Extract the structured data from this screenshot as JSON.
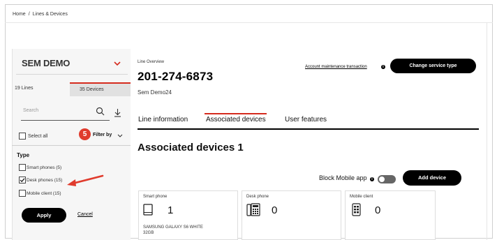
{
  "breadcrumb": {
    "home": "Home",
    "separator": "/",
    "current": "Lines & Devices"
  },
  "sidebar": {
    "account_name": "SEM DEMO",
    "tabs": {
      "lines": "19 Lines",
      "devices": "35 Devices"
    },
    "search_placeholder": "Search",
    "select_all": "Select all",
    "step_badge": "5",
    "filter_by": "Filter by",
    "type_heading": "Type",
    "options": [
      {
        "label": "Smart phones (5)",
        "checked": false
      },
      {
        "label": "Desk phones (15)",
        "checked": true
      },
      {
        "label": "Mobile client (15)",
        "checked": false
      }
    ],
    "apply": "Apply",
    "cancel": "Cancel"
  },
  "main": {
    "line_overview_label": "Line Overview",
    "phone_number": "201-274-6873",
    "line_name": "Sem Demo24",
    "account_link": "Account maintenance transaction",
    "change_service_button": "Change service type",
    "tabs": [
      {
        "label": "Line information",
        "active": false
      },
      {
        "label": "Associated devices",
        "active": true
      },
      {
        "label": "User features",
        "active": false
      }
    ],
    "section_title": "Associated devices 1",
    "block_mobile_label": "Block Mobile app",
    "add_device_button": "Add device",
    "cards": [
      {
        "title": "Smart phone",
        "count": "1",
        "device": "SAMSUNG GALAXY S6 WHITE 32GB",
        "icon": "tablet-icon"
      },
      {
        "title": "Desk phone",
        "count": "0",
        "device": "",
        "icon": "desk-phone-icon"
      },
      {
        "title": "Mobile client",
        "count": "0",
        "device": "",
        "icon": "mobile-client-icon"
      }
    ]
  },
  "colors": {
    "accent": "#d52b1e",
    "badge": "#e03b2d",
    "button": "#000000"
  }
}
